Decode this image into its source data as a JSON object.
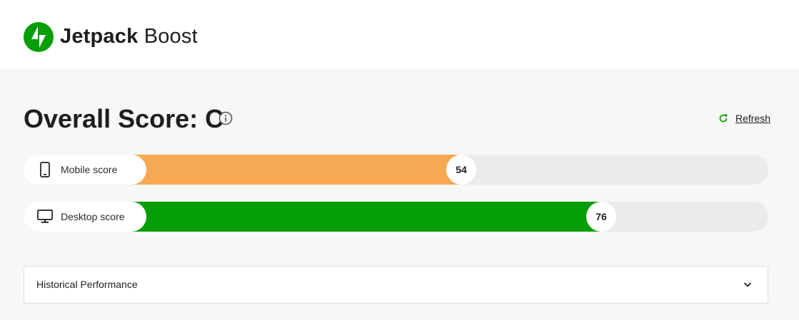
{
  "header": {
    "brand_bold": "Jetpack",
    "brand_light": "Boost",
    "logo_icon": "jetpack-logo-icon",
    "brand_color": "#069e08"
  },
  "overview": {
    "title": "Overall Score: C",
    "info_icon": "info-icon",
    "refresh_label": "Refresh",
    "refresh_icon": "refresh-icon"
  },
  "scores": [
    {
      "label": "Mobile score",
      "value": "54",
      "icon": "mobile-phone-icon",
      "color": "#f6a852"
    },
    {
      "label": "Desktop score",
      "value": "76",
      "icon": "desktop-monitor-icon",
      "color": "#069e08"
    }
  ],
  "history": {
    "label": "Historical Performance",
    "toggle_icon": "chevron-down-icon"
  }
}
